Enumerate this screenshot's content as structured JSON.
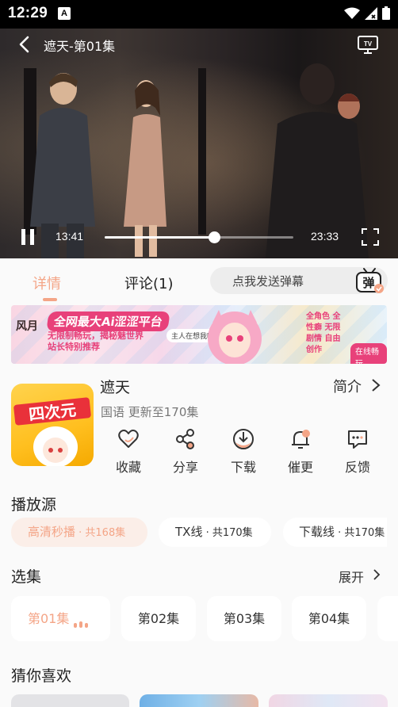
{
  "status_bar": {
    "time": "12:29",
    "notification_icon": "A"
  },
  "player": {
    "title": "遮天-第01集",
    "current_time": "13:41",
    "total_time": "23:33",
    "progress": 0.581
  },
  "tabs": [
    {
      "label": "详情",
      "active": true
    },
    {
      "label": "评论(1)",
      "active": false
    }
  ],
  "danmaku": {
    "placeholder": "点我发送弹幕",
    "icon_text": "弹"
  },
  "ad_banner": {
    "logo": "风月",
    "headline": "全网最大Ai涩涩平台",
    "sub": "无限制畅玩，揭秘魅世界 站长特别推荐",
    "bubble": "主人在想我吗?",
    "tags": "全角色 全性癖 无限剧情 自由创作",
    "button": "在线畅玩"
  },
  "show": {
    "title": "遮天",
    "meta": "国语 更新至170集",
    "intro_label": "简介",
    "cover_text": "四次元"
  },
  "actions": [
    {
      "label": "收藏",
      "icon": "heart-icon"
    },
    {
      "label": "分享",
      "icon": "share-icon"
    },
    {
      "label": "下载",
      "icon": "download-icon"
    },
    {
      "label": "催更",
      "icon": "bell-icon"
    },
    {
      "label": "反馈",
      "icon": "feedback-icon"
    }
  ],
  "sources": {
    "title": "播放源",
    "items": [
      {
        "name": "高清秒播",
        "count": " · 共168集",
        "active": true
      },
      {
        "name": "TX线",
        "count": " · 共170集",
        "active": false
      },
      {
        "name": "下载线",
        "count": " · 共170集",
        "active": false
      }
    ]
  },
  "episodes": {
    "title": "选集",
    "expand_label": "展开",
    "items": [
      {
        "label": "第01集",
        "active": true
      },
      {
        "label": "第02集",
        "active": false
      },
      {
        "label": "第03集",
        "active": false
      },
      {
        "label": "第04集",
        "active": false
      }
    ]
  },
  "recommend": {
    "title": "猜你喜欢"
  },
  "colors": {
    "accent": "#f4a587",
    "panel": "#fafafa",
    "chip": "#ffffff"
  }
}
